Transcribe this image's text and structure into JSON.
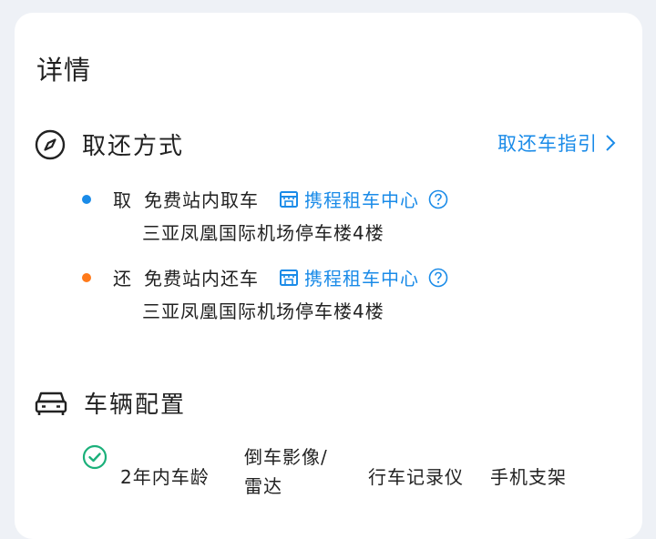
{
  "page": {
    "title": "详情"
  },
  "pickup_return": {
    "heading": "取还方式",
    "guide_label": "取还车指引",
    "pickup": {
      "kind": "取",
      "description": "免费站内取车",
      "store_name": "携程租车中心",
      "address": "三亚凤凰国际机场停车楼4楼",
      "dot_color": "#1a8be8"
    },
    "return": {
      "kind": "还",
      "description": "免费站内还车",
      "store_name": "携程租车中心",
      "address": "三亚凤凰国际机场停车楼4楼",
      "dot_color": "#ff7a1a"
    }
  },
  "vehicle": {
    "heading": "车辆配置",
    "features": [
      "2年内车龄",
      "倒车影像/雷达",
      "行车记录仪",
      "手机支架"
    ]
  },
  "colors": {
    "accent": "#1a8be8",
    "check": "#1bb07a",
    "orange": "#ff7a1a"
  },
  "icons": {
    "pickup_return": "compass-icon",
    "vehicle": "car-icon",
    "store": "store-icon",
    "help": "help-circle-icon",
    "guide": "chevron-right-icon",
    "feature": "check-circle-icon"
  }
}
